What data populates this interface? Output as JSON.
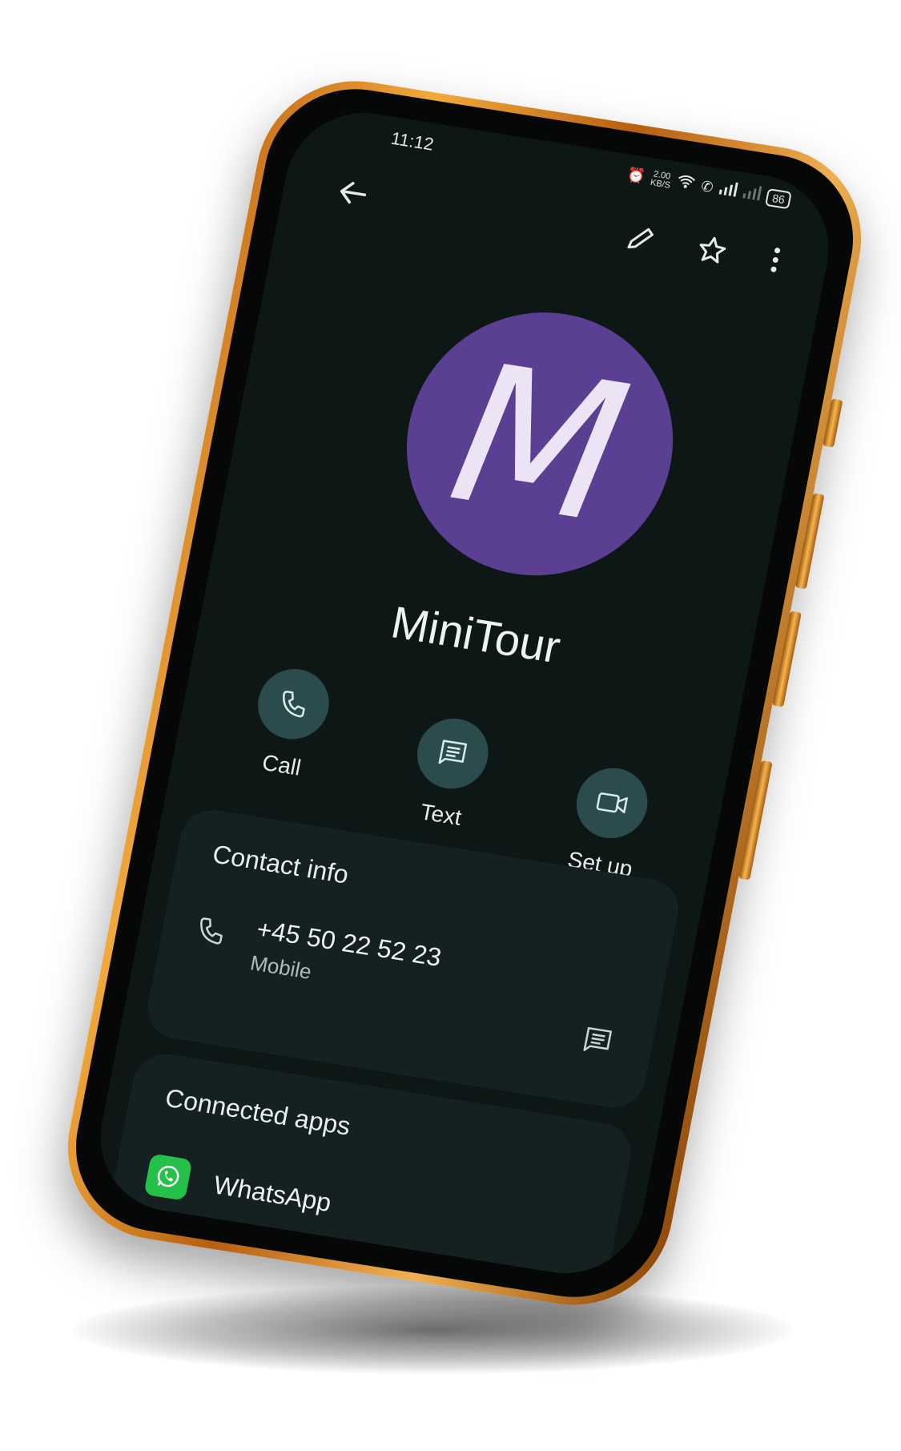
{
  "status_bar": {
    "time": "11:12",
    "net_speed_value": "2.00",
    "net_speed_unit": "KB/S",
    "battery": "86"
  },
  "contact": {
    "avatar_letter": "M",
    "name": "MiniTour",
    "avatar_color": "#5b3f93"
  },
  "actions": [
    {
      "label": "Call",
      "icon": "phone-icon"
    },
    {
      "label": "Text",
      "icon": "message-icon"
    },
    {
      "label": "Set up",
      "icon": "video-icon"
    }
  ],
  "contact_info": {
    "title": "Contact info",
    "phone_number": "+45 50 22 52 23",
    "phone_type": "Mobile"
  },
  "connected_apps": {
    "title": "Connected apps",
    "apps": [
      {
        "name": "WhatsApp",
        "icon": "whatsapp-icon",
        "color": "#25c04a"
      }
    ]
  },
  "app_bar": {
    "icons": [
      "back-arrow-icon",
      "edit-pencil-icon",
      "star-icon",
      "more-vert-icon"
    ]
  }
}
